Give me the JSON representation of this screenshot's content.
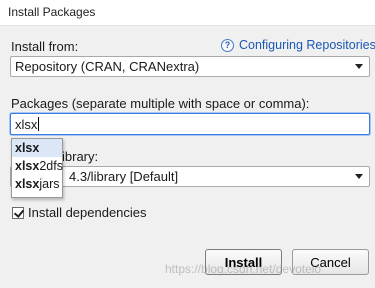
{
  "window": {
    "title": "Install Packages"
  },
  "install_from": {
    "label": "Install from:",
    "value": "Repository (CRAN, CRANextra)"
  },
  "help_link": {
    "icon": "question-icon",
    "text": "Configuring Repositories"
  },
  "packages": {
    "label": "Packages (separate multiple with space or comma):",
    "value": "xlsx"
  },
  "library": {
    "label_tail": "ibrary:",
    "value": "4.3/library [Default]"
  },
  "suggestions": [
    {
      "bold": "xlsx",
      "rest": ""
    },
    {
      "bold": "xlsx",
      "rest": "2dfs"
    },
    {
      "bold": "xlsx",
      "rest": "jars"
    }
  ],
  "dependencies": {
    "label": "Install dependencies",
    "checked": true
  },
  "buttons": {
    "install": "Install",
    "cancel": "Cancel"
  },
  "watermark": "https://blog.csdn.net/devotelo"
}
